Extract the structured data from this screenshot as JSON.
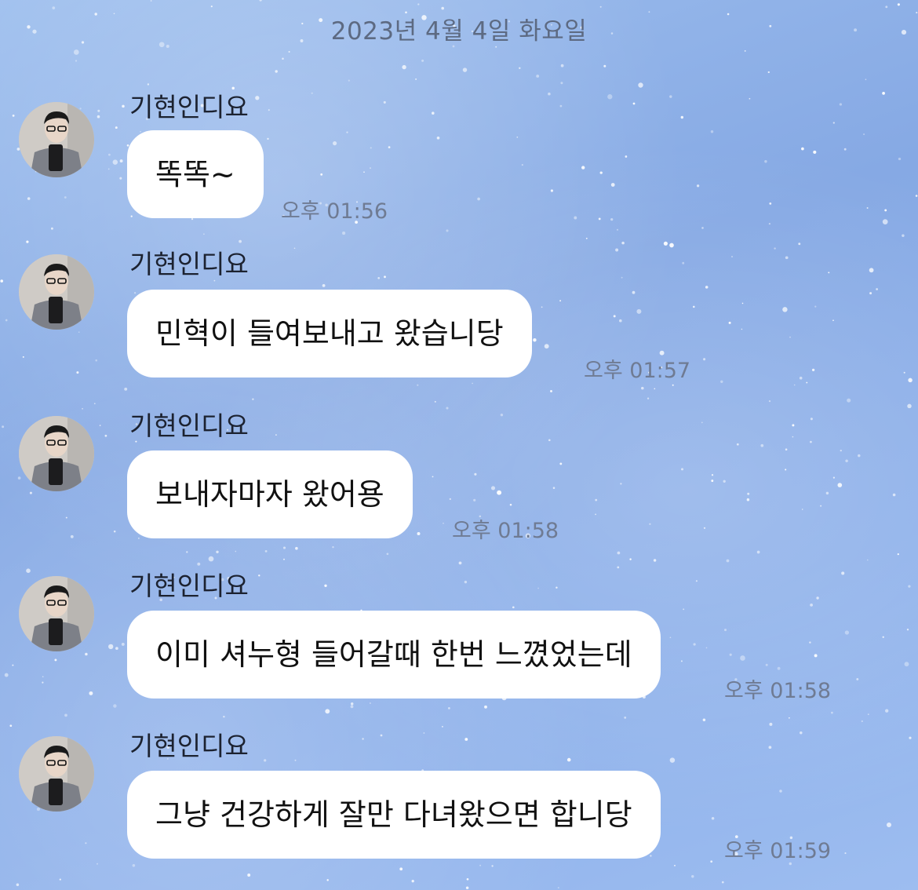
{
  "chat": {
    "date_header": "2023년 4월 4일 화요일",
    "messages": [
      {
        "sender": "기현인디요",
        "text": "똑똑~",
        "time": "오후 01:56"
      },
      {
        "sender": "기현인디요",
        "text": "민혁이 들여보내고 왔습니당",
        "time": "오후 01:57"
      },
      {
        "sender": "기현인디요",
        "text": "보내자마자 왔어용",
        "time": "오후 01:58"
      },
      {
        "sender": "기현인디요",
        "text": "이미 셔누형 들어갈때 한번 느꼈었는데",
        "time": "오후 01:58"
      },
      {
        "sender": "기현인디요",
        "text": "그냥 건강하게 잘만 다녀왔으면 합니당",
        "time": "오후 01:59"
      }
    ]
  },
  "theme": {
    "background": "#8fb3ea",
    "bubble": "#ffffff",
    "timestamp_color": "#6f7b93"
  }
}
